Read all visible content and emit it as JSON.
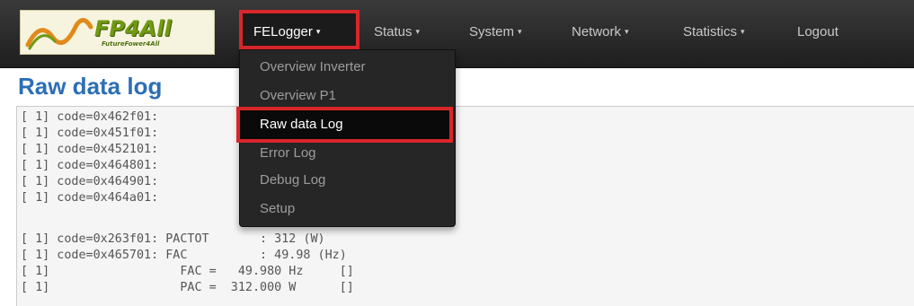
{
  "brand": {
    "logo_text": "FP4All",
    "logo_subtext": "FutureFower4All"
  },
  "nav": {
    "items": [
      {
        "label": "FELogger",
        "caret": "▾"
      },
      {
        "label": "Status",
        "caret": "▾"
      },
      {
        "label": "System",
        "caret": "▾"
      },
      {
        "label": "Network",
        "caret": "▾"
      },
      {
        "label": "Statistics",
        "caret": "▾"
      },
      {
        "label": "Logout",
        "caret": ""
      }
    ],
    "active_index": 0,
    "highlight_color": "#d9262b"
  },
  "dropdown": {
    "items": [
      {
        "label": "Overview Inverter"
      },
      {
        "label": "Overview P1"
      },
      {
        "label": "Raw data Log"
      },
      {
        "label": "Error Log"
      },
      {
        "label": "Debug Log"
      },
      {
        "label": "Setup"
      }
    ],
    "selected_index": 2
  },
  "page": {
    "title": "Raw data log",
    "title_color": "#2c6fb5"
  },
  "log": {
    "lines": [
      "[ 1] code=0x462f01:              5 (h)",
      "[ 1] code=0x451f01:               (V)",
      "[ 1] code=0x452101:               (A)",
      "[ 1] code=0x464801:               (V)",
      "[ 1] code=0x464901:              V)",
      "[ 1] code=0x464a01:              V)",
      "[ 1] code=0x263f01: PACTOT       : 312 (W)",
      "[ 1] code=0x465701: FAC          : 49.98 (Hz)",
      "[ 1]                  FAC =   49.980 Hz     []",
      "[ 1]                  PAC =  312.000 W      []"
    ]
  }
}
